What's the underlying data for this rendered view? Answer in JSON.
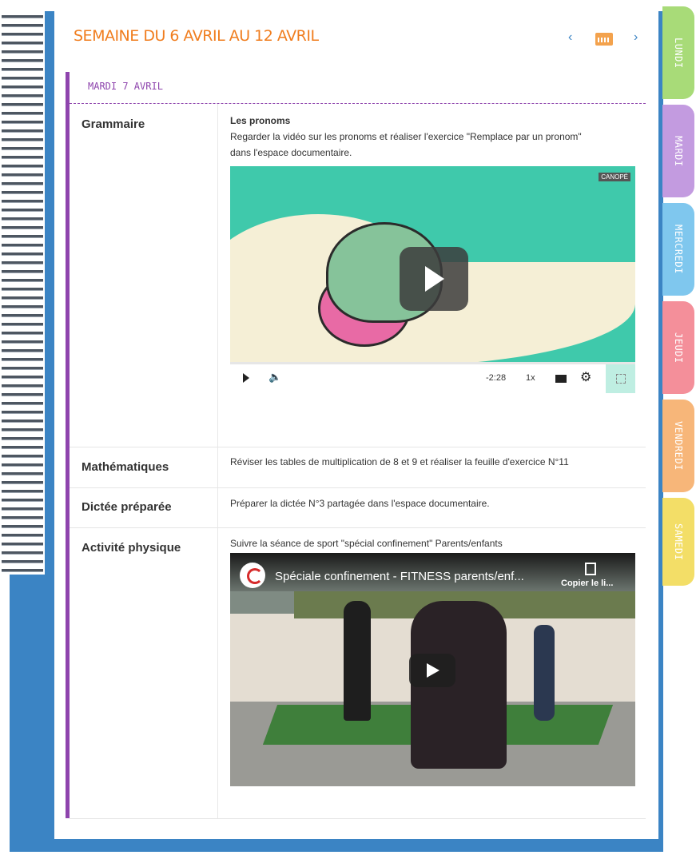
{
  "header": {
    "week_title": "SEMAINE DU 6 AVRIL AU 12 AVRIL",
    "prev_label": "‹",
    "next_label": "›"
  },
  "tabs": [
    {
      "label": "LUNDI",
      "color": "#a8db78"
    },
    {
      "label": "MARDI",
      "color": "#c39be0"
    },
    {
      "label": "MERCREDI",
      "color": "#7fc7ee"
    },
    {
      "label": "JEUDI",
      "color": "#f48f9a"
    },
    {
      "label": "VENDREDI",
      "color": "#f7b679"
    },
    {
      "label": "SAMEDI",
      "color": "#f3de67"
    }
  ],
  "day": {
    "title": "MARDI 7 AVRIL",
    "accent": "#8e44ad"
  },
  "rows": [
    {
      "subject": "Grammaire",
      "heading": "Les pronoms",
      "line1": "Regarder la vidéo sur les pronoms et réaliser l'exercice \"Remplace par un pronom\"",
      "line2": "dans l'espace documentaire."
    },
    {
      "subject": "Mathématiques",
      "text": "Réviser les tables de  multiplication de 8 et 9 et réaliser la feuille d'exercice N°11"
    },
    {
      "subject": "Dictée préparée",
      "text": "Préparer la dictée N°3 partagée dans l'espace documentaire."
    },
    {
      "subject": "Activité physique",
      "text": "Suivre la séance de sport \"spécial confinement\" Parents/enfants"
    }
  ],
  "video1": {
    "channel_logo": "CANOPÉ",
    "time": "-2:28",
    "speed": "1x",
    "icons": [
      "play-icon",
      "volume-icon",
      "captions-icon",
      "gear-icon",
      "fullscreen-icon"
    ]
  },
  "video2": {
    "title": "Spéciale confinement - FITNESS parents/enf...",
    "copy_label": "Copier le li..."
  },
  "colors": {
    "binding": "#3b84c4",
    "title_orange": "#f07d1e"
  }
}
